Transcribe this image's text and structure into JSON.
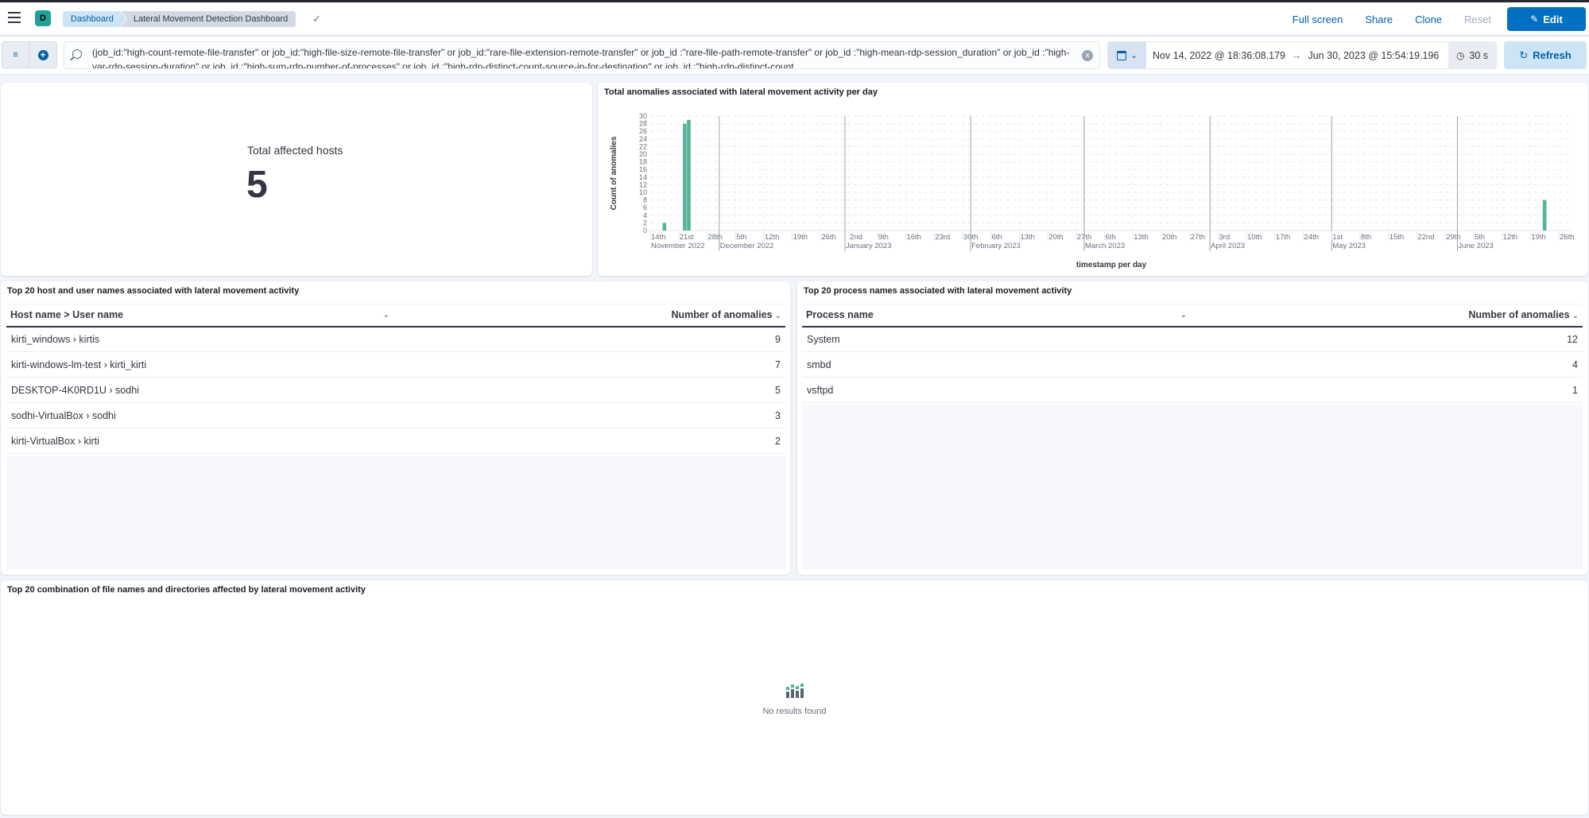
{
  "header": {
    "space_initial": "D",
    "breadcrumbs": [
      "Dashboard",
      "Lateral Movement Detection Dashboard"
    ],
    "actions": {
      "full_screen": "Full screen",
      "share": "Share",
      "clone": "Clone",
      "reset": "Reset",
      "edit": "Edit"
    }
  },
  "query_bar": {
    "query": "(job_id:\"high-count-remote-file-transfer\" or job_id:\"high-file-size-remote-file-transfer\" or job_id:\"rare-file-extension-remote-transfer\" or job_id :\"rare-file-path-remote-transfer\" or job_id :\"high-mean-rdp-session_duration\" or job_id :\"high-var-rdp-session-duration\" or job_id :\"high-sum-rdp-number-of-processes\" or job_id :\"high-rdp-distinct-count-source-ip-for-destination\" or job_id :\"high-rdp-distinct-count",
    "date_start": "Nov 14, 2022 @ 18:36:08.179",
    "date_arrow": "→",
    "date_end": "Jun 30, 2023 @ 15:54:19.196",
    "refresh_interval": "30 s",
    "refresh_label": "Refresh"
  },
  "metric_panel": {
    "label": "Total affected hosts",
    "value": "5"
  },
  "chart_panel": {
    "title": "Total anomalies associated with lateral movement activity per day"
  },
  "chart_data": {
    "type": "bar",
    "title": "Total anomalies associated with lateral movement activity per day",
    "xlabel": "timestamp per day",
    "ylabel": "Count of anomalies",
    "ylim": [
      0,
      30
    ],
    "yticks": [
      0,
      2,
      4,
      6,
      8,
      10,
      12,
      14,
      16,
      18,
      20,
      22,
      24,
      26,
      28,
      30
    ],
    "xlim": [
      "2022-11-14",
      "2023-06-30"
    ],
    "grid": true,
    "bar_color": "#54b399",
    "x": [
      "2022-11-17",
      "2022-11-22",
      "2022-11-23",
      "2023-06-22"
    ],
    "values": [
      2,
      28,
      29,
      8
    ],
    "x_ticks": [
      {
        "date": "2022-11-14",
        "label": "14th"
      },
      {
        "date": "2022-11-21",
        "label": "21st"
      },
      {
        "date": "2022-11-28",
        "label": "28th"
      },
      {
        "date": "2022-12-05",
        "label": "5th"
      },
      {
        "date": "2022-12-12",
        "label": "12th"
      },
      {
        "date": "2022-12-19",
        "label": "19th"
      },
      {
        "date": "2022-12-26",
        "label": "26th"
      },
      {
        "date": "2023-01-02",
        "label": "2nd"
      },
      {
        "date": "2023-01-09",
        "label": "9th"
      },
      {
        "date": "2023-01-16",
        "label": "16th"
      },
      {
        "date": "2023-01-23",
        "label": "23rd"
      },
      {
        "date": "2023-01-30",
        "label": "30th"
      },
      {
        "date": "2023-02-06",
        "label": "6th"
      },
      {
        "date": "2023-02-13",
        "label": "13th"
      },
      {
        "date": "2023-02-20",
        "label": "20th"
      },
      {
        "date": "2023-02-27",
        "label": "27th"
      },
      {
        "date": "2023-03-06",
        "label": "6th"
      },
      {
        "date": "2023-03-13",
        "label": "13th"
      },
      {
        "date": "2023-03-20",
        "label": "20th"
      },
      {
        "date": "2023-03-27",
        "label": "27th"
      },
      {
        "date": "2023-04-03",
        "label": "3rd"
      },
      {
        "date": "2023-04-10",
        "label": "10th"
      },
      {
        "date": "2023-04-17",
        "label": "17th"
      },
      {
        "date": "2023-04-24",
        "label": "24th"
      },
      {
        "date": "2023-05-01",
        "label": "1st"
      },
      {
        "date": "2023-05-08",
        "label": "8th"
      },
      {
        "date": "2023-05-15",
        "label": "15th"
      },
      {
        "date": "2023-05-22",
        "label": "22nd"
      },
      {
        "date": "2023-05-29",
        "label": "29th"
      },
      {
        "date": "2023-06-05",
        "label": "5th"
      },
      {
        "date": "2023-06-12",
        "label": "12th"
      },
      {
        "date": "2023-06-19",
        "label": "19th"
      },
      {
        "date": "2023-06-26",
        "label": "26th"
      }
    ],
    "month_labels": [
      {
        "date": "2022-11-14",
        "label": "November 2022",
        "divider": false
      },
      {
        "date": "2022-12-01",
        "label": "December 2022",
        "divider": true
      },
      {
        "date": "2023-01-01",
        "label": "January 2023",
        "divider": true
      },
      {
        "date": "2023-02-01",
        "label": "February 2023",
        "divider": true
      },
      {
        "date": "2023-03-01",
        "label": "March 2023",
        "divider": true
      },
      {
        "date": "2023-04-01",
        "label": "April 2023",
        "divider": true
      },
      {
        "date": "2023-05-01",
        "label": "May 2023",
        "divider": true
      },
      {
        "date": "2023-06-01",
        "label": "June 2023",
        "divider": true
      }
    ]
  },
  "hosts_table": {
    "title": "Top 20 host and user names associated with lateral movement activity",
    "columns": [
      "Host name > User name",
      "Number of anomalies"
    ],
    "rows": [
      {
        "name": "kirti_windows › kirtis",
        "count": "9"
      },
      {
        "name": "kirti-windows-lm-test › kirti_kirti",
        "count": "7"
      },
      {
        "name": "DESKTOP-4K0RD1U › sodhi",
        "count": "5"
      },
      {
        "name": "sodhi-VirtualBox › sodhi",
        "count": "3"
      },
      {
        "name": "kirti-VirtualBox › kirti",
        "count": "2"
      }
    ]
  },
  "process_table": {
    "title": "Top 20 process names associated with lateral movement activity",
    "columns": [
      "Process name",
      "Number of anomalies"
    ],
    "rows": [
      {
        "name": "System",
        "count": "12"
      },
      {
        "name": "smbd",
        "count": "4"
      },
      {
        "name": "vsftpd",
        "count": "1"
      }
    ]
  },
  "files_panel": {
    "title": "Top 20 combination of file names and directories affected by lateral movement activity",
    "empty_text": "No results found"
  }
}
